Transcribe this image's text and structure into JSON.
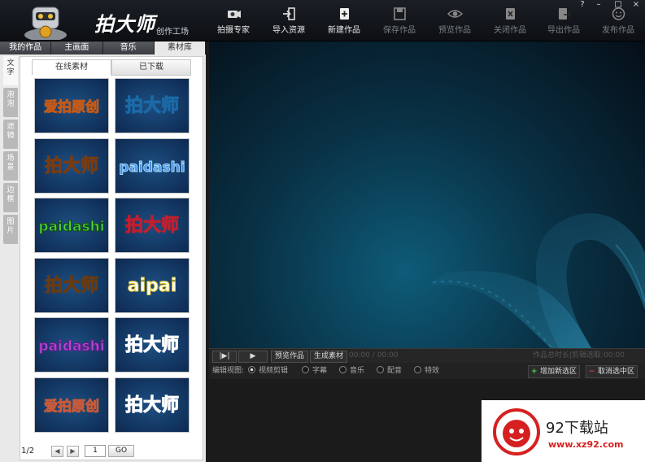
{
  "app": {
    "brand": "拍大师",
    "brand_sub": "创作工场"
  },
  "window_controls": [
    "?",
    "–",
    "□",
    "×"
  ],
  "toolbar": [
    {
      "label": "拍摄专家",
      "icon": "camera-icon",
      "enabled": true
    },
    {
      "label": "导入资源",
      "icon": "import-icon",
      "enabled": true
    },
    {
      "label": "新建作品",
      "icon": "new-file-icon",
      "enabled": true
    },
    {
      "label": "保存作品",
      "icon": "save-icon",
      "enabled": false
    },
    {
      "label": "预览作品",
      "icon": "eye-icon",
      "enabled": false
    },
    {
      "label": "关闭作品",
      "icon": "close-file-icon",
      "enabled": false
    },
    {
      "label": "导出作品",
      "icon": "export-icon",
      "enabled": false
    },
    {
      "label": "发布作品",
      "icon": "smile-icon",
      "enabled": false
    }
  ],
  "left_tabs": [
    {
      "label": "我的作品",
      "active": false
    },
    {
      "label": "主画面",
      "active": false
    },
    {
      "label": "音乐",
      "active": false
    },
    {
      "label": "素材库",
      "active": true
    }
  ],
  "vertical_tabs": [
    {
      "label": "文字",
      "active": true
    },
    {
      "label": "泡泡",
      "active": false
    },
    {
      "label": "滤镜",
      "active": false
    },
    {
      "label": "场景",
      "active": false
    },
    {
      "label": "边框",
      "active": false
    },
    {
      "label": "图片",
      "active": false
    }
  ],
  "sub_tabs": [
    {
      "label": "在线素材",
      "active": true
    },
    {
      "label": "已下载",
      "active": false
    }
  ],
  "tiles": [
    {
      "text": "爱拍原创",
      "fill": "#f3e7a6",
      "stroke": "#c25a1a"
    },
    {
      "text": "拍大师",
      "fill": "#48c9ef",
      "stroke": "#1b6aa7"
    },
    {
      "text": "拍大师",
      "fill": "#f2a33a",
      "stroke": "#7a3b10"
    },
    {
      "text": "paidashi",
      "fill": "#3f8fe8",
      "stroke": "#a9dcff"
    },
    {
      "text": "paidashi",
      "fill": "#4fd43b",
      "stroke": "#0f4a10"
    },
    {
      "text": "拍大师",
      "fill": "#f7f7f7",
      "stroke": "#c21e2e"
    },
    {
      "text": "拍大师",
      "fill": "#e8902a",
      "stroke": "#6a3a10"
    },
    {
      "text": "aipai",
      "fill": "#ffffff",
      "stroke": "#e5c82a"
    },
    {
      "text": "paidashi",
      "fill": "#b04ad8",
      "stroke": "#6b1a8a"
    },
    {
      "text": "拍大师",
      "fill": "#f46bb0",
      "stroke": "#ffffff"
    },
    {
      "text": "爱拍原创",
      "fill": "#f4d9c0",
      "stroke": "#c65a3a"
    },
    {
      "text": "拍大师",
      "fill": "#b8c8d6",
      "stroke": "#ffffff"
    }
  ],
  "pager": {
    "info": "1/2",
    "page_value": "1",
    "go": "GO"
  },
  "controls": {
    "preview": "预览作品",
    "generate": "生成素材",
    "time": "00:00 / 00:00",
    "duration_text": "作品总时长|剪辑选取:00:00"
  },
  "edit_view": {
    "label": "编辑视图:",
    "options": [
      {
        "label": "视频剪辑",
        "selected": true
      },
      {
        "label": "字幕",
        "selected": false
      },
      {
        "label": "音乐",
        "selected": false
      },
      {
        "label": "配音",
        "selected": false
      },
      {
        "label": "特效",
        "selected": false
      }
    ],
    "add_btn": "增加新选区",
    "cancel_btn": "取消选中区"
  },
  "watermark": {
    "name": "92下载站",
    "url": "www.xz92.com"
  }
}
